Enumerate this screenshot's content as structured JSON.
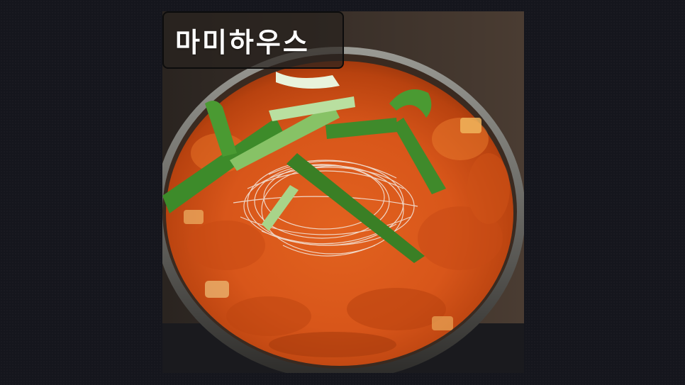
{
  "overlay": {
    "title": "마미하우스"
  },
  "photo": {
    "subject_icon": "stew-pot-photo"
  }
}
